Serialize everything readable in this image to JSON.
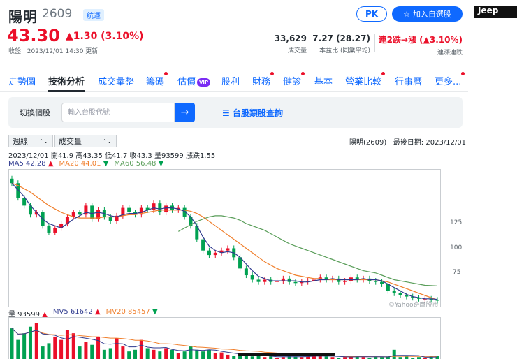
{
  "header": {
    "name": "陽明",
    "code": "2609",
    "industry": "航運",
    "pk_label": "PK",
    "watch_label": "加入自選股"
  },
  "quote": {
    "price": "43.30",
    "change": "▲1.30 (3.10%)",
    "close_time": "收盤 | 2023/12/01 14:30 更新"
  },
  "stats": [
    {
      "value": "33,629",
      "label": "成交量",
      "color": "#232a31"
    },
    {
      "value": "7.27 (28.27)",
      "label": "本益比 (同業平均)",
      "color": "#232a31"
    },
    {
      "value": "連2跌→漲 (▲3.10%)",
      "label": "連漲連跌",
      "color": "#eb0f29"
    }
  ],
  "tabs": [
    "走勢圖",
    "技術分析",
    "成交彙整",
    "籌碼",
    "估價",
    "股利",
    "財務",
    "健診",
    "基本",
    "營業比較",
    "行事曆",
    "更多..."
  ],
  "vip_label": "VIP",
  "search": {
    "label": "切換個股",
    "placeholder": "輸入台股代號",
    "category_link": "台股類股查詢"
  },
  "controls": {
    "period": "週線",
    "indicator": "成交量"
  },
  "chart_info": {
    "symbol": "陽明(2609)",
    "last_date": "最後日期: 2023/12/01"
  },
  "ohlc": "2023/12/01 開41.9 高43.35 低41.7 收43.3 量93599 漲跌1.55",
  "ma": {
    "ma5": "MA5 42.28",
    "ma20": "MA20 44.01",
    "ma60": "MA60 56.48"
  },
  "vol_ma": {
    "vol": "量 93599",
    "mv5": "MV5 61642",
    "mv20": "MV20 85457"
  },
  "colors": {
    "up": "#eb0f29",
    "down": "#00a151",
    "ma5": "#2f3b8f",
    "ma20": "#f07f2c",
    "ma60": "#5a9e5a"
  },
  "ad_text": "Jeep",
  "watermark": "©Yahoo奇摩股市",
  "chart_data": {
    "type": "candlestick",
    "x_range": [
      "2020-12",
      "2023-12"
    ],
    "ylim": [
      43,
      155
    ],
    "yticks": [
      75,
      100,
      125
    ],
    "close": [
      148,
      135,
      128,
      120,
      122,
      110,
      104,
      108,
      112,
      118,
      122,
      120,
      128,
      116,
      124,
      118,
      114,
      119,
      126,
      122,
      120,
      126,
      124,
      130,
      122,
      128,
      124,
      126,
      118,
      110,
      98,
      88,
      84,
      86,
      88,
      90,
      82,
      72,
      66,
      62,
      60,
      62,
      60,
      61,
      63,
      60,
      59,
      60,
      61,
      62,
      64,
      62,
      63,
      60,
      61,
      64,
      62,
      63,
      61,
      60,
      58,
      52,
      50,
      48,
      47,
      46,
      45,
      45,
      44,
      43.3
    ],
    "ma5": [
      148,
      142,
      136,
      128,
      122,
      116,
      112,
      110,
      108,
      112,
      116,
      119,
      122,
      121,
      122,
      121,
      119,
      118,
      120,
      121,
      121,
      122,
      124,
      126,
      125,
      126,
      126,
      125,
      123,
      118,
      110,
      100,
      92,
      88,
      86,
      87,
      86,
      82,
      76,
      70,
      65,
      63,
      61,
      61,
      61,
      61,
      61,
      60,
      60,
      61,
      62,
      62,
      63,
      62,
      62,
      62,
      62,
      63,
      62,
      62,
      61,
      58,
      55,
      52,
      49,
      47,
      46,
      45,
      45,
      44.5
    ],
    "ma20": [
      148,
      146,
      143,
      140,
      136,
      132,
      128,
      125,
      122,
      120,
      118,
      117,
      117,
      117,
      117,
      118,
      118,
      118,
      119,
      120,
      120,
      121,
      122,
      123,
      124,
      124,
      124,
      124,
      124,
      123,
      121,
      118,
      114,
      110,
      106,
      102,
      98,
      94,
      90,
      86,
      82,
      78,
      75,
      72,
      70,
      68,
      66,
      65,
      64,
      63,
      63,
      62,
      62,
      62,
      62,
      62,
      62,
      62,
      62,
      62,
      61,
      60,
      58,
      56,
      54,
      52,
      50,
      48,
      46,
      44
    ],
    "ma60": [
      null,
      null,
      null,
      null,
      null,
      null,
      null,
      null,
      null,
      null,
      null,
      null,
      null,
      null,
      null,
      null,
      null,
      null,
      null,
      null,
      null,
      null,
      null,
      null,
      null,
      null,
      null,
      105,
      108,
      111,
      114,
      116,
      118,
      119,
      119,
      118,
      117,
      115,
      112,
      110,
      108,
      106,
      103,
      100,
      97,
      94,
      92,
      90,
      88,
      86,
      84,
      82,
      80,
      78,
      76,
      74,
      72,
      70,
      69,
      68,
      66,
      64,
      62,
      61,
      60,
      59,
      58,
      57,
      56.8,
      56.48
    ],
    "volume": [
      95,
      60,
      80,
      100,
      110,
      40,
      50,
      70,
      60,
      90,
      80,
      40,
      55,
      45,
      70,
      30,
      35,
      65,
      40,
      25,
      30,
      60,
      35,
      30,
      25,
      35,
      30,
      20,
      25,
      40,
      30,
      25,
      30,
      20,
      22,
      15,
      12,
      18,
      14,
      10,
      12,
      8,
      10,
      6,
      8,
      12,
      10,
      8,
      10,
      14,
      12,
      10,
      8,
      6,
      8,
      10,
      12,
      8,
      6,
      10,
      8,
      10,
      30,
      8,
      10,
      6,
      8,
      6,
      10,
      12
    ]
  }
}
